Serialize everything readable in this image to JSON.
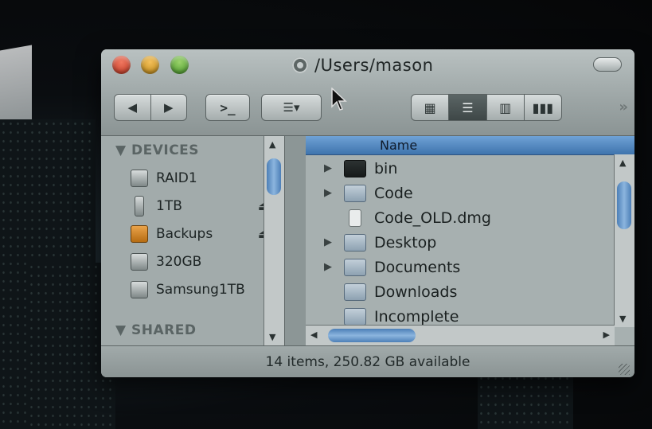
{
  "window": {
    "title": "/Users/mason",
    "toolbar": {
      "back_icon": "◀",
      "forward_icon": "▶",
      "terminal_label": ">_",
      "arrange_icon": "☰▾",
      "view_icon_grid": "▦",
      "view_icon_list": "☰",
      "view_icon_columns": "▥",
      "view_icon_coverflow": "▮▮▮",
      "more_icon": "»"
    },
    "sidebar": {
      "devices_header": "DEVICES",
      "shared_header": "SHARED",
      "devices": [
        {
          "label": "RAID1",
          "icon": "hard-drive-icon",
          "eject": ""
        },
        {
          "label": "1TB",
          "icon": "external-drive-icon",
          "eject": "⏏"
        },
        {
          "label": "Backups",
          "icon": "time-machine-drive-icon",
          "eject": "⏏"
        },
        {
          "label": "320GB",
          "icon": "hard-drive-icon",
          "eject": ""
        },
        {
          "label": "Samsung1TB",
          "icon": "hard-drive-icon",
          "eject": ""
        }
      ]
    },
    "list": {
      "column_name": "Name",
      "items": [
        {
          "name": "bin",
          "type": "folder-dark",
          "expandable": true
        },
        {
          "name": "Code",
          "type": "folder",
          "expandable": true
        },
        {
          "name": "Code_OLD.dmg",
          "type": "document",
          "expandable": false
        },
        {
          "name": "Desktop",
          "type": "folder",
          "expandable": true
        },
        {
          "name": "Documents",
          "type": "folder",
          "expandable": true
        },
        {
          "name": "Downloads",
          "type": "folder",
          "expandable": false
        },
        {
          "name": "Incomplete",
          "type": "folder",
          "expandable": false
        }
      ]
    },
    "status": "14 items, 250.82 GB available"
  }
}
